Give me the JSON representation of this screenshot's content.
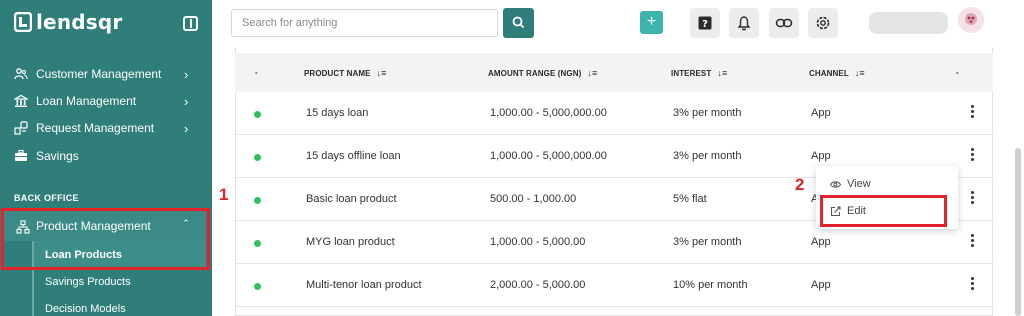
{
  "app": {
    "logo_text": "lendsqr"
  },
  "sidebar": {
    "items": [
      {
        "label": "Customer Management",
        "icon": "users-icon"
      },
      {
        "label": "Loan Management",
        "icon": "bank-icon"
      },
      {
        "label": "Request Management",
        "icon": "request-icon"
      },
      {
        "label": "Savings",
        "icon": "briefcase-icon"
      }
    ],
    "section_label": "BACK OFFICE",
    "product_management": {
      "label": "Product Management",
      "icon": "sitemap-icon"
    },
    "sub_items": [
      {
        "label": "Loan Products",
        "active": true
      },
      {
        "label": "Savings Products"
      },
      {
        "label": "Decision Models"
      }
    ]
  },
  "header": {
    "search_placeholder": "Search for anything",
    "plus_label": "+"
  },
  "table": {
    "columns": [
      {
        "label": "-"
      },
      {
        "label": "PRODUCT NAME",
        "sortable": true
      },
      {
        "label": "AMOUNT RANGE (NGN)",
        "sortable": true
      },
      {
        "label": "INTEREST",
        "sortable": true
      },
      {
        "label": "CHANNEL",
        "sortable": true
      },
      {
        "label": "-"
      }
    ],
    "sort_glyph": "↓≡",
    "rows": [
      {
        "status": "active",
        "name": "15 days loan",
        "amount": "1,000.00 - 5,000,000.00",
        "interest": "3% per month",
        "channel": "App"
      },
      {
        "status": "active",
        "name": "15 days offline loan",
        "amount": "1,000.00 - 5,000,000.00",
        "interest": "3% per month",
        "channel": "App"
      },
      {
        "status": "active",
        "name": "Basic loan product",
        "amount": "500.00 - 1,000.00",
        "interest": "5% flat",
        "channel": "App"
      },
      {
        "status": "active",
        "name": "MYG loan product",
        "amount": "1,000.00 - 5,000.00",
        "interest": "3% per month",
        "channel": "App"
      },
      {
        "status": "active",
        "name": "Multi-tenor loan product",
        "amount": "2,000.00 - 5,000.00",
        "interest": "10% per month",
        "channel": "App"
      }
    ]
  },
  "context_menu": {
    "items": [
      {
        "label": "View",
        "icon": "eye-icon"
      },
      {
        "label": "Edit",
        "icon": "edit-icon"
      }
    ]
  },
  "annotations": {
    "step1": "1",
    "step2": "2"
  },
  "colors": {
    "sidebar": "#2f7e7a",
    "accent": "#3bb5ae",
    "status_active": "#2fc25c",
    "annotation": "#e3222b"
  }
}
